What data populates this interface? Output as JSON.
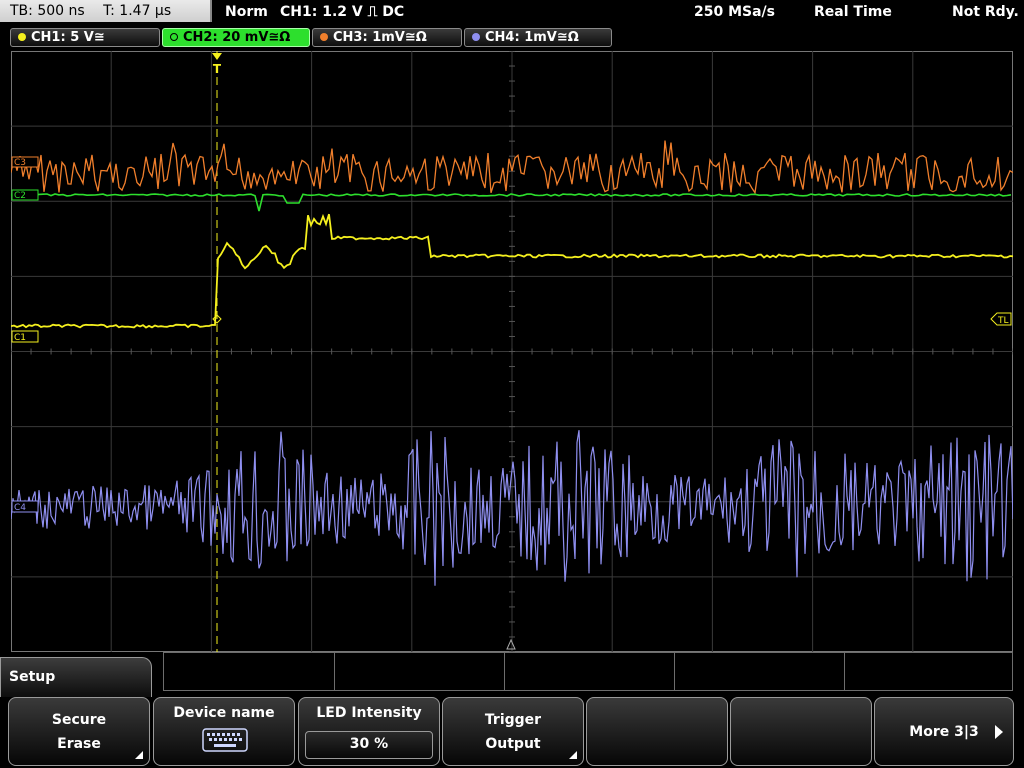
{
  "status": {
    "timebase": "TB: 500 ns",
    "trigger_time": "T: 1.47 µs",
    "mode": "Norm",
    "trigger_info": "CH1: 1.2 V ⎍ DC",
    "sample_rate": "250 MSa/s",
    "acq_mode": "Real Time",
    "state": "Not Rdy."
  },
  "channels": [
    {
      "label": "CH1: 5 V≅",
      "color": "#f5f01e"
    },
    {
      "label": "CH2: 20 mV≅Ω",
      "color": "#2ddf2d"
    },
    {
      "label": "CH3: 1mV≅Ω",
      "color": "#f07f2c"
    },
    {
      "label": "CH4: 1mV≅Ω",
      "color": "#8f8ff0"
    }
  ],
  "markers": {
    "trigger": "T",
    "tl": "TL",
    "c1": "C1",
    "c2": "C2",
    "c3": "C3",
    "c4": "C4"
  },
  "menu": {
    "title": "Setup",
    "softkeys": [
      {
        "line1": "Secure",
        "line2": "Erase"
      },
      {
        "line1": "Device name",
        "icon": "keyboard-icon"
      },
      {
        "line1": "LED Intensity",
        "value": "30 %"
      },
      {
        "line1": "Trigger",
        "line2": "Output"
      },
      {
        "line1": ""
      },
      {
        "line1": ""
      },
      {
        "line1": "More 3|3"
      }
    ]
  }
}
